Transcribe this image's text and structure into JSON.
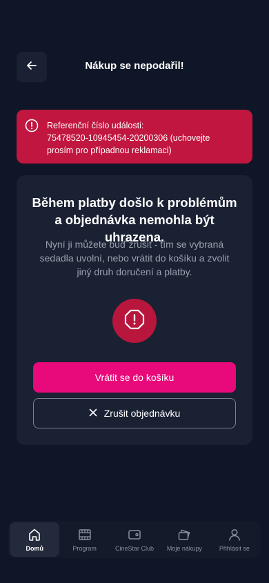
{
  "header": {
    "title": "Nákup se nepodařil!",
    "back_icon": "arrow-left-icon"
  },
  "error_banner": {
    "icon": "alert-circle-icon",
    "line1": "Referenční číslo události:",
    "line2": "75478520-10945454-20200306 (uchovejte",
    "line3": "prosím pro případnou reklamaci)",
    "color": "#c0163f"
  },
  "card": {
    "title_line1": "Během platby došlo k problémům",
    "title_line2": "a objednávka nemohla být uhrazena.",
    "desc_line1": "Nyní ji můžete buď zrušit - tím se vybraná",
    "desc_line2": "sedadla uvolní, nebo vrátit do košíku a zvolit",
    "desc_line3": "jiný druh doručení a platby.",
    "status_icon": "alert-octagon-icon",
    "primary_button": "Vrátit se do košíku",
    "secondary_button": "Zrušit objednávku",
    "accent": "#e8097a"
  },
  "bottom_nav": {
    "items": [
      {
        "label": "Domů",
        "icon": "home-icon",
        "active": true
      },
      {
        "label": "Program",
        "icon": "film-icon",
        "active": false
      },
      {
        "label": "CineStar Club",
        "icon": "wallet-card-icon",
        "active": false
      },
      {
        "label": "Moje nákupy",
        "icon": "tickets-icon",
        "active": false
      },
      {
        "label": "Přihlásit se",
        "icon": "user-icon",
        "active": false
      }
    ]
  }
}
